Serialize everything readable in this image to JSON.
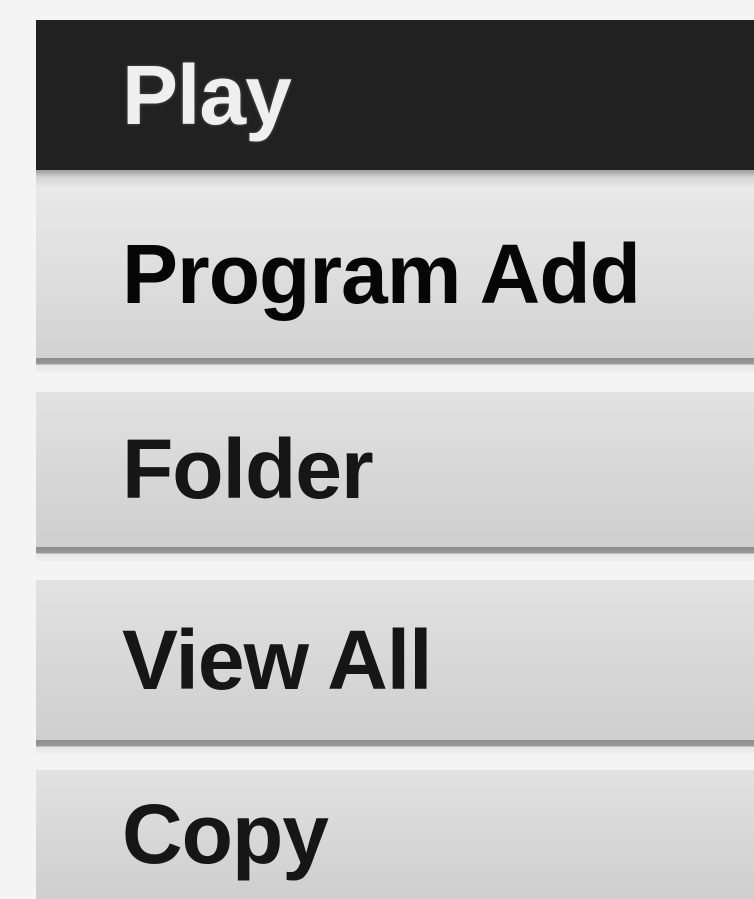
{
  "menu": {
    "items": [
      {
        "label": "Play",
        "state": "selected"
      },
      {
        "label": "Program Add",
        "state": "focused"
      },
      {
        "label": "Folder",
        "state": "normal"
      },
      {
        "label": "View All",
        "state": "normal"
      },
      {
        "label": "Copy",
        "state": "normal"
      }
    ]
  },
  "colors": {
    "selected_background": "#212121",
    "selected_text": "#efefef",
    "item_background": "#d6d6d6",
    "item_text": "#161616",
    "separator": "#8d8d8d",
    "page_background": "#f4f4f4"
  }
}
